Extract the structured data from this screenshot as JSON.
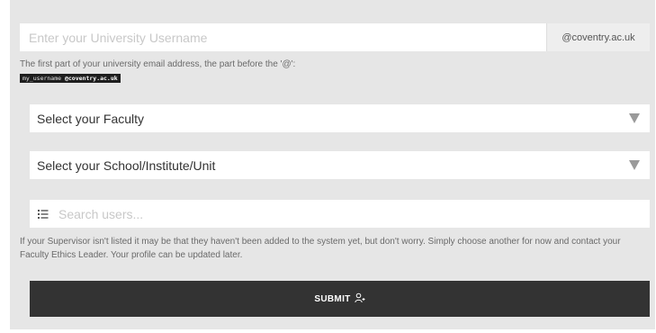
{
  "username": {
    "placeholder": "Enter your University Username",
    "domain_suffix": "@coventry.ac.uk",
    "help_text": "The first part of your university email address, the part before the '@':",
    "example_user": "my_username",
    "example_domain": "@coventry.ac.uk"
  },
  "faculty_select": {
    "selected": "Select your Faculty",
    "icon": "triangle-down"
  },
  "school_select": {
    "selected": "Select your School/Institute/Unit",
    "icon": "triangle-down"
  },
  "supervisor_search": {
    "placeholder": "Search users...",
    "icon": "list-icon",
    "note": "If your Supervisor isn't listed it may be that they haven't been added to the system yet, but don't worry. Simply choose another for now and contact your Faculty Ethics Leader. Your profile can be updated later."
  },
  "submit": {
    "label": "SUBMIT",
    "icon": "user-plus-icon"
  },
  "colors": {
    "panel_bg": "#e6e6e6",
    "button_bg": "#333333",
    "chip_bg": "#1e1e1e"
  }
}
